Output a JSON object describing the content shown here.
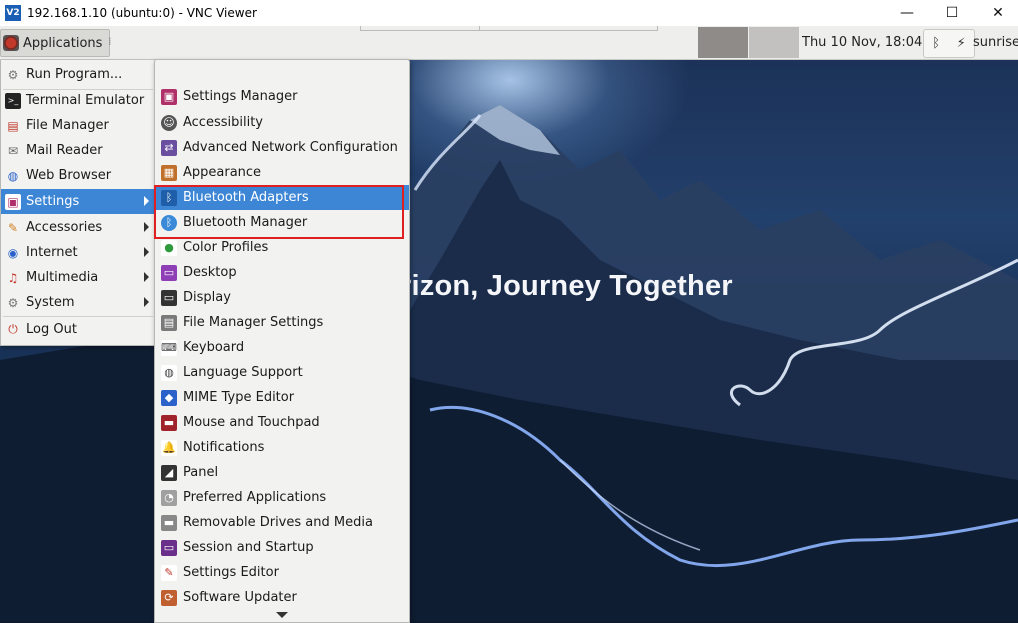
{
  "window": {
    "icon_text": "V2",
    "title": "192.168.1.10 (ubuntu:0) - VNC Viewer",
    "minimize": "—",
    "maximize": "☐",
    "close": "✕"
  },
  "panel": {
    "applications_label": "Applications",
    "handle": "⁞",
    "clock": "Thu 10 Nov, 18:04",
    "tray_bluetooth": "ᛒ",
    "tray_network": "⚡",
    "user": "sunrise"
  },
  "desktop": {
    "slogan": "rizon, Journey Together"
  },
  "menu": {
    "items": [
      {
        "label": "Run Program...",
        "icon": "gear-icon",
        "glyph": "⚙"
      },
      {
        "label": "Terminal Emulator",
        "icon": "terminal-icon",
        "glyph": ">_"
      },
      {
        "label": "File Manager",
        "icon": "folder-icon",
        "glyph": "▤"
      },
      {
        "label": "Mail Reader",
        "icon": "mail-icon",
        "glyph": "✉"
      },
      {
        "label": "Web Browser",
        "icon": "globe-icon",
        "glyph": "◍"
      },
      {
        "label": "Settings",
        "icon": "settings-icon",
        "glyph": "▣"
      },
      {
        "label": "Accessories",
        "icon": "accessories-icon",
        "glyph": "✎"
      },
      {
        "label": "Internet",
        "icon": "internet-icon",
        "glyph": "◉"
      },
      {
        "label": "Multimedia",
        "icon": "multimedia-icon",
        "glyph": "♫"
      },
      {
        "label": "System",
        "icon": "system-icon",
        "glyph": "⚙"
      },
      {
        "label": "Log Out",
        "icon": "logout-icon",
        "glyph": "⏻"
      }
    ]
  },
  "submenu": {
    "items": [
      {
        "label": "Settings Manager",
        "icon": "settings-manager-icon",
        "glyph": "▣",
        "color": "#b0306a"
      },
      {
        "label": "Accessibility",
        "icon": "accessibility-icon",
        "glyph": "☺",
        "color": "#555555"
      },
      {
        "label": "Advanced Network Configuration",
        "icon": "network-icon",
        "glyph": "⇄",
        "color": "#6a4fa0"
      },
      {
        "label": "Appearance",
        "icon": "appearance-icon",
        "glyph": "▦",
        "color": "#c0702a"
      },
      {
        "label": "Bluetooth Adapters",
        "icon": "bluetooth-adapter-icon",
        "glyph": "ᛒ",
        "color": "#1f5faa"
      },
      {
        "label": "Bluetooth Manager",
        "icon": "bluetooth-manager-icon",
        "glyph": "ᛒ",
        "color": "#3a8ad8"
      },
      {
        "label": "Color Profiles",
        "icon": "color-profiles-icon",
        "glyph": "●",
        "color": "#2e9a3c"
      },
      {
        "label": "Desktop",
        "icon": "desktop-icon",
        "glyph": "▭",
        "color": "#8e3fb5"
      },
      {
        "label": "Display",
        "icon": "display-icon",
        "glyph": "▭",
        "color": "#333333"
      },
      {
        "label": "File Manager Settings",
        "icon": "file-manager-settings-icon",
        "glyph": "▤",
        "color": "#7a7a7a"
      },
      {
        "label": "Keyboard",
        "icon": "keyboard-icon",
        "glyph": "⌨",
        "color": "#444444"
      },
      {
        "label": "Language Support",
        "icon": "language-icon",
        "glyph": "◍",
        "color": "#444444"
      },
      {
        "label": "MIME Type Editor",
        "icon": "mime-icon",
        "glyph": "◆",
        "color": "#2a62c9"
      },
      {
        "label": "Mouse and Touchpad",
        "icon": "mouse-icon",
        "glyph": "▬",
        "color": "#a0232b"
      },
      {
        "label": "Notifications",
        "icon": "bell-icon",
        "glyph": "🔔",
        "color": "#e0a020"
      },
      {
        "label": "Panel",
        "icon": "panel-icon",
        "glyph": "◢",
        "color": "#333333"
      },
      {
        "label": "Preferred Applications",
        "icon": "preferred-apps-icon",
        "glyph": "◔",
        "color": "#a0a0a0"
      },
      {
        "label": "Removable Drives and Media",
        "icon": "drive-icon",
        "glyph": "▬",
        "color": "#888888"
      },
      {
        "label": "Session and Startup",
        "icon": "session-icon",
        "glyph": "▭",
        "color": "#6a2f8a"
      },
      {
        "label": "Settings Editor",
        "icon": "settings-editor-icon",
        "glyph": "✎",
        "color": "#c0392b"
      },
      {
        "label": "Software Updater",
        "icon": "updater-icon",
        "glyph": "⟳",
        "color": "#c06030"
      }
    ]
  }
}
